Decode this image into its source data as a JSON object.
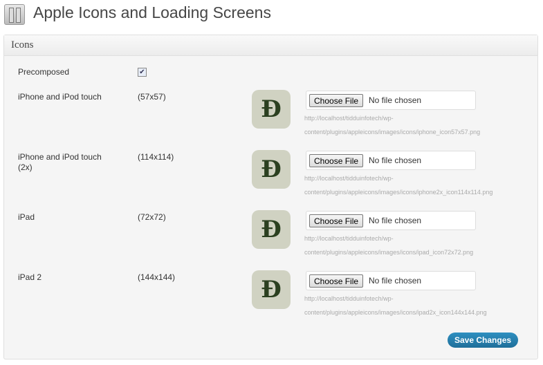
{
  "title": "Apple Icons and Loading Screens",
  "section": "Icons",
  "precomposed": {
    "label": "Precomposed",
    "checked": true
  },
  "choose_label": "Choose File",
  "no_file": "No file chosen",
  "rows": [
    {
      "label": "iPhone and iPod touch",
      "size": "(57x57)",
      "url1": "http://localhost/tidduinfotech/wp-",
      "url2": "content/plugins/appleicons/images/icons/iphone_icon57x57.png"
    },
    {
      "label": "iPhone and iPod touch (2x)",
      "size": "(114x114)",
      "url1": "http://localhost/tidduinfotech/wp-",
      "url2": "content/plugins/appleicons/images/icons/iphone2x_icon114x114.png"
    },
    {
      "label": "iPad",
      "size": "(72x72)",
      "url1": "http://localhost/tidduinfotech/wp-",
      "url2": "content/plugins/appleicons/images/icons/ipad_icon72x72.png"
    },
    {
      "label": "iPad 2",
      "size": "(144x144)",
      "url1": "http://localhost/tidduinfotech/wp-",
      "url2": "content/plugins/appleicons/images/icons/ipad2x_icon144x144.png"
    }
  ],
  "icon_glyph": "Đ",
  "save": "Save Changes"
}
